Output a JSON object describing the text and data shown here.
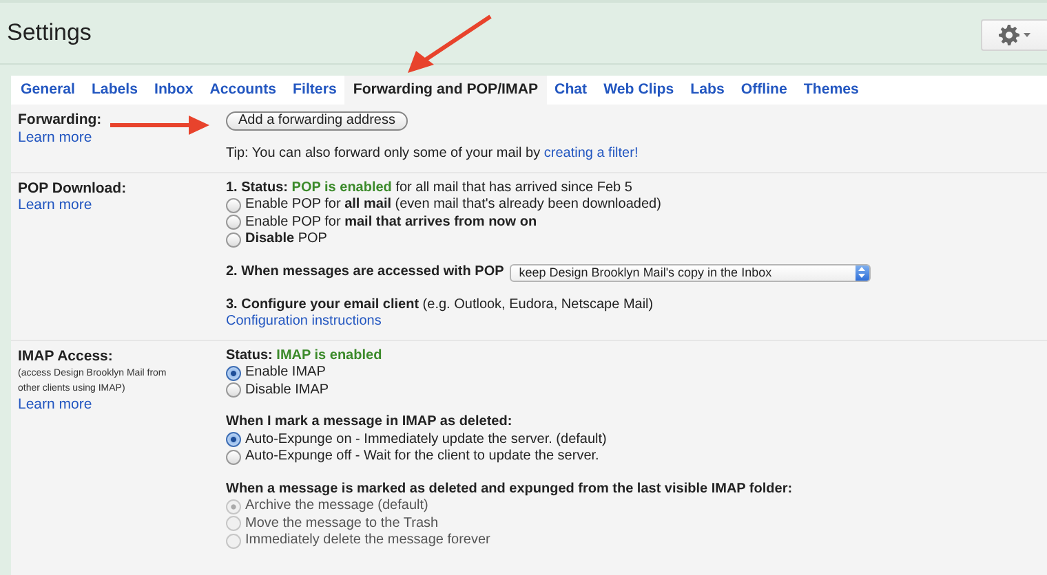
{
  "title": "Settings",
  "tabs": [
    {
      "label": "General",
      "selected": false
    },
    {
      "label": "Labels",
      "selected": false
    },
    {
      "label": "Inbox",
      "selected": false
    },
    {
      "label": "Accounts",
      "selected": false
    },
    {
      "label": "Filters",
      "selected": false
    },
    {
      "label": "Forwarding and POP/IMAP",
      "selected": true
    },
    {
      "label": "Chat",
      "selected": false
    },
    {
      "label": "Web Clips",
      "selected": false
    },
    {
      "label": "Labs",
      "selected": false
    },
    {
      "label": "Offline",
      "selected": false
    },
    {
      "label": "Themes",
      "selected": false
    }
  ],
  "sections": [
    {
      "label": "Forwarding:",
      "learn_more": "Learn more",
      "blocks": [
        [
          {
            "kind": "button",
            "text": "Add a forwarding address"
          }
        ],
        [
          {
            "kind": "tip",
            "text": "Tip: You can also forward only some of your mail by",
            "link": "creating a filter!"
          }
        ]
      ]
    },
    {
      "label": "POP Download:",
      "learn_more": "Learn more",
      "blocks": [
        [
          {
            "kind": "status",
            "prefix": "1. Status:",
            "value": "POP is enabled",
            "suffix": "for all mail that has arrived since Feb 5"
          },
          {
            "kind": "radio",
            "text": "Enable POP for **all mail** (even mail that's already been downloaded)",
            "selected": false,
            "disabled": false
          },
          {
            "kind": "radio",
            "text": "Enable POP for **mail that arrives from now on**",
            "selected": false,
            "disabled": false
          },
          {
            "kind": "radio",
            "text": "**Disable** POP",
            "selected": false,
            "disabled": false
          }
        ],
        [
          {
            "kind": "select",
            "text": "2. When messages are accessed with POP",
            "value": "keep Design Brooklyn Mail's copy in the Inbox"
          }
        ],
        [
          {
            "kind": "text",
            "text": "**3. Configure your email client** (e.g. Outlook, Eudora, Netscape Mail)"
          },
          {
            "kind": "link",
            "text": "Configuration instructions"
          }
        ]
      ]
    },
    {
      "label": "IMAP Access:",
      "note": "(access Design Brooklyn Mail from other clients using IMAP)",
      "learn_more": "Learn more",
      "blocks": [
        [
          {
            "kind": "status",
            "prefix": "Status:",
            "value": "IMAP is enabled"
          },
          {
            "kind": "radio",
            "text": "Enable IMAP",
            "selected": true,
            "disabled": false
          },
          {
            "kind": "radio",
            "text": "Disable IMAP",
            "selected": false,
            "disabled": false
          }
        ],
        [
          {
            "kind": "heading",
            "text": "When I mark a message in IMAP as deleted:"
          },
          {
            "kind": "radio",
            "text": "Auto-Expunge on - Immediately update the server. (default)",
            "selected": true,
            "disabled": false
          },
          {
            "kind": "radio",
            "text": "Auto-Expunge off - Wait for the client to update the server.",
            "selected": false,
            "disabled": false
          }
        ],
        [
          {
            "kind": "heading",
            "text": "When a message is marked as deleted and expunged from the last visible IMAP folder:"
          },
          {
            "kind": "radio",
            "text": "Archive the message (default)",
            "selected": true,
            "disabled": true
          },
          {
            "kind": "radio",
            "text": "Move the message to the Trash",
            "selected": false,
            "disabled": true
          },
          {
            "kind": "radio",
            "text": "Immediately delete the message forever",
            "selected": false,
            "disabled": true
          }
        ]
      ]
    }
  ]
}
